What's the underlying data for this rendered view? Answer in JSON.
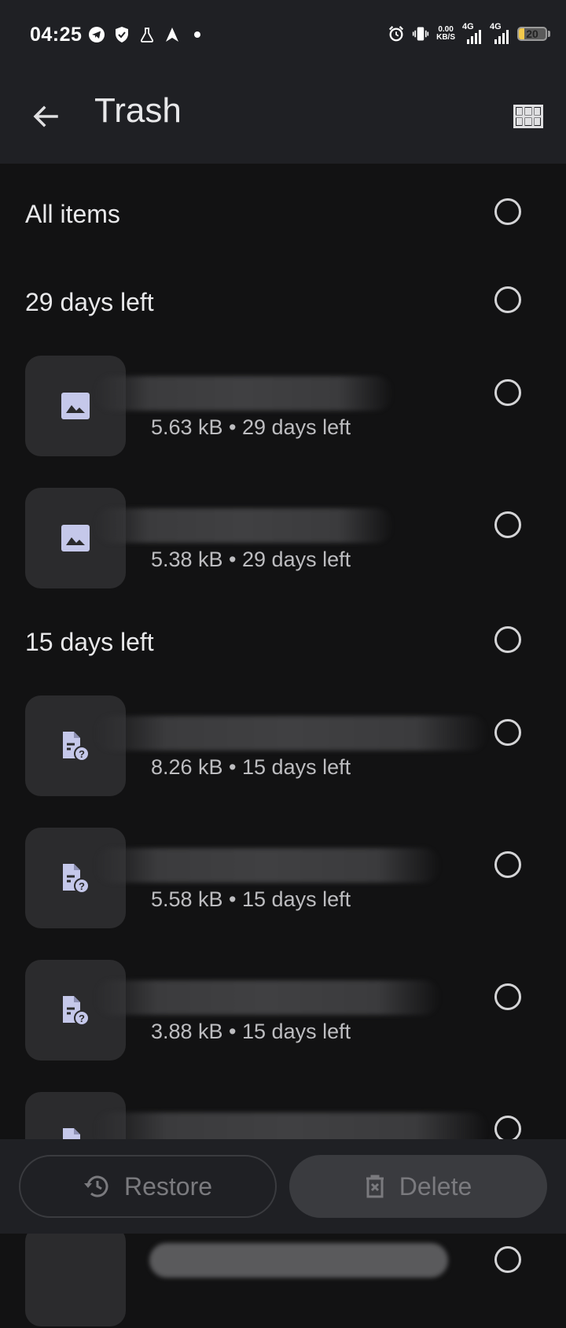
{
  "status_bar": {
    "time": "04:25",
    "speed_value": "0.00",
    "speed_unit": "KB/S",
    "net1": "4G",
    "net2": "4G",
    "battery_level": "20"
  },
  "app_bar": {
    "title": "Trash"
  },
  "sections": [
    {
      "label": "All items"
    },
    {
      "label": "29 days left"
    },
    {
      "label": "15 days left"
    }
  ],
  "files": [
    {
      "meta": "5.63 kB • 29 days left",
      "type": "image"
    },
    {
      "meta": "5.38 kB • 29 days left",
      "type": "image"
    },
    {
      "meta": "8.26 kB • 15 days left",
      "type": "unknown"
    },
    {
      "meta": "5.58 kB • 15 days left",
      "type": "unknown"
    },
    {
      "meta": "3.88 kB • 15 days left",
      "type": "unknown"
    }
  ],
  "actions": {
    "restore_label": "Restore",
    "delete_label": "Delete"
  },
  "colors": {
    "background": "#121213",
    "surface": "#1f2024",
    "thumb": "#2b2b2d",
    "icon": "#c5c8ea",
    "battery": "#f2c94c"
  }
}
